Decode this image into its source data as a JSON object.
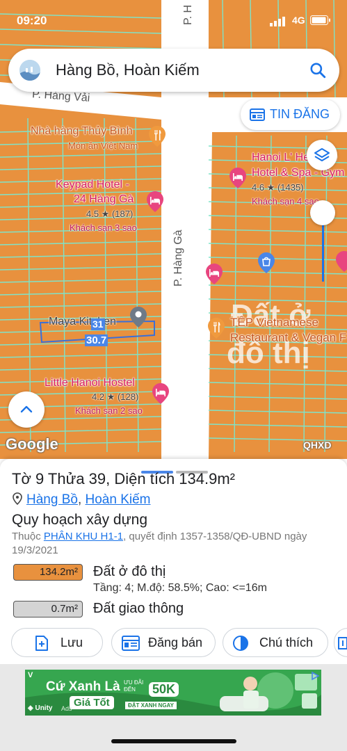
{
  "status_bar": {
    "time": "09:20",
    "network": "4G"
  },
  "search": {
    "text": "Hàng Bồ, Hoàn Kiếm"
  },
  "tin_dang_label": "TIN ĐĂNG",
  "map": {
    "streets": [
      "P. Hàng Vải",
      "P. Hàng Gà",
      "P. Hàng Gà"
    ],
    "pois": {
      "thuy_binh": {
        "name": "Nhà hàng Thủy Bình",
        "sub": "Món ăn Việt Nam"
      },
      "keypad": {
        "name1": "Keypad Hotel -",
        "name2": "24 Hàng Gà",
        "rating": "4.5 ★ (187)",
        "sub": "Khách sạn 3 sao"
      },
      "hanoi_l": {
        "name1": "Hanoi L' Heritage",
        "name2": "Hotel & Spa - Gym",
        "rating": "4.6 ★ (1435)",
        "sub": "Khách sạn 4 sao"
      },
      "maya": {
        "name": "Maya Kitchen"
      },
      "tep": {
        "name1": "TÊP Vietnamese",
        "name2": "Restaurant & Vegan F"
      },
      "little_hanoi": {
        "name": "Little Hanoi Hostel",
        "rating": "4.2 ★ (128)",
        "sub": "Khách sạn 2 sao"
      }
    },
    "zone_label": [
      "Đất ở",
      "đô thị"
    ],
    "parcel_number": "31",
    "parcel_edge": "30.7",
    "google_label": "Google",
    "qhxd_label": "QHXD"
  },
  "parcel": {
    "title": "Tờ 9 Thửa 39, Diện tích 134.9m²",
    "ward": "Hàng Bồ",
    "district": "Hoàn Kiếm",
    "section_title": "Quy hoạch xây dựng",
    "desc_prefix": "Thuộc ",
    "desc_link": "PHÂN KHU H1-1",
    "desc_suffix": ", quyết định 1357-1358/QĐ-UBND ngày 19/3/2021",
    "land_uses": [
      {
        "area": "134.2m²",
        "name": "Đất ở đô thị",
        "detail": "Tầng: 4; M.độ: 58.5%; Cao: <=16m",
        "color": "#e8913e"
      },
      {
        "area": "0.7m²",
        "name": "Đất giao thông",
        "detail": "",
        "color": "#d4d4d4"
      }
    ]
  },
  "actions": {
    "save": "Lưu",
    "post": "Đăng bán",
    "legend": "Chú thích"
  },
  "ad": {
    "headline1": "Cứ Xanh Là",
    "headline2": "Giá Tốt",
    "promo_top": "ƯU ĐÃI ĐẾN",
    "promo_value": "50K",
    "promo_cta": "ĐẶT XANH NGAY",
    "brand": "Unity",
    "tag": "Ads"
  },
  "colors": {
    "accent": "#1a73e8",
    "residential_land": "#e8913e",
    "parcel_line": "#7fe3c8"
  }
}
